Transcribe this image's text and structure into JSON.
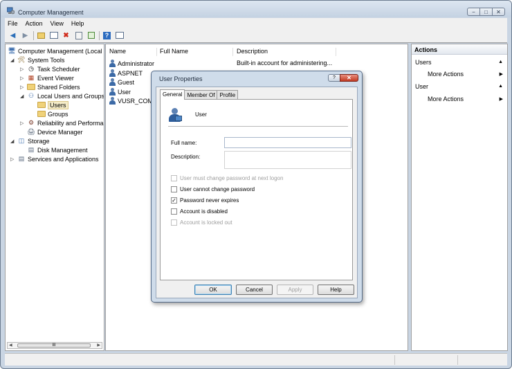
{
  "window": {
    "title": "Computer Management",
    "controls": [
      "−",
      "□",
      "✕"
    ]
  },
  "menu": [
    "File",
    "Action",
    "View",
    "Help"
  ],
  "tree": {
    "items": [
      {
        "label": "Computer Management (Local",
        "icon": "computer-management-icon"
      },
      {
        "label": "System Tools",
        "icon": "system-tools-icon"
      },
      {
        "label": "Task Scheduler",
        "icon": "clock-icon"
      },
      {
        "label": "Event Viewer",
        "icon": "event-viewer-icon"
      },
      {
        "label": "Shared Folders",
        "icon": "shared-folders-icon"
      },
      {
        "label": "Local Users and Groups",
        "icon": "users-groups-icon"
      },
      {
        "label": "Users",
        "icon": "folder-icon"
      },
      {
        "label": "Groups",
        "icon": "folder-icon"
      },
      {
        "label": "Reliability and Performa",
        "icon": "reliability-icon"
      },
      {
        "label": "Device Manager",
        "icon": "device-manager-icon"
      },
      {
        "label": "Storage",
        "icon": "storage-icon"
      },
      {
        "label": "Disk Management",
        "icon": "disk-icon"
      },
      {
        "label": "Services and Applications",
        "icon": "services-icon"
      }
    ],
    "scroll_thumb_label": "III"
  },
  "list": {
    "columns": [
      "Name",
      "Full Name",
      "Description"
    ],
    "rows": [
      {
        "name": "Administrator",
        "full_name": "",
        "description": "Built-in account for administering..."
      },
      {
        "name": "ASPNET",
        "full_name": "",
        "description": ""
      },
      {
        "name": "Guest",
        "full_name": "",
        "description": ""
      },
      {
        "name": "User",
        "full_name": "",
        "description": ""
      },
      {
        "name": "VUSR_COM...",
        "full_name": "",
        "description": ""
      }
    ]
  },
  "actions": {
    "header": "Actions",
    "sections": [
      {
        "title": "Users",
        "item": "More Actions"
      },
      {
        "title": "User",
        "item": "More Actions"
      }
    ]
  },
  "dialog": {
    "title": "User Properties",
    "help_label": "?",
    "close_label": "✕",
    "tabs": [
      "General",
      "Member Of",
      "Profile"
    ],
    "user_name": "User",
    "full_name_label": "Full name:",
    "full_name_value": "",
    "description_label": "Description:",
    "description_value": "",
    "checkboxes": [
      {
        "label": "User must change password at next logon",
        "checked": false,
        "enabled": false
      },
      {
        "label": "User cannot change password",
        "checked": false,
        "enabled": true
      },
      {
        "label": "Password never expires",
        "checked": true,
        "enabled": true
      },
      {
        "label": "Account is disabled",
        "checked": false,
        "enabled": true
      },
      {
        "label": "Account is locked out",
        "checked": false,
        "enabled": false
      }
    ],
    "buttons": {
      "ok": "OK",
      "cancel": "Cancel",
      "apply": "Apply",
      "help": "Help"
    }
  }
}
